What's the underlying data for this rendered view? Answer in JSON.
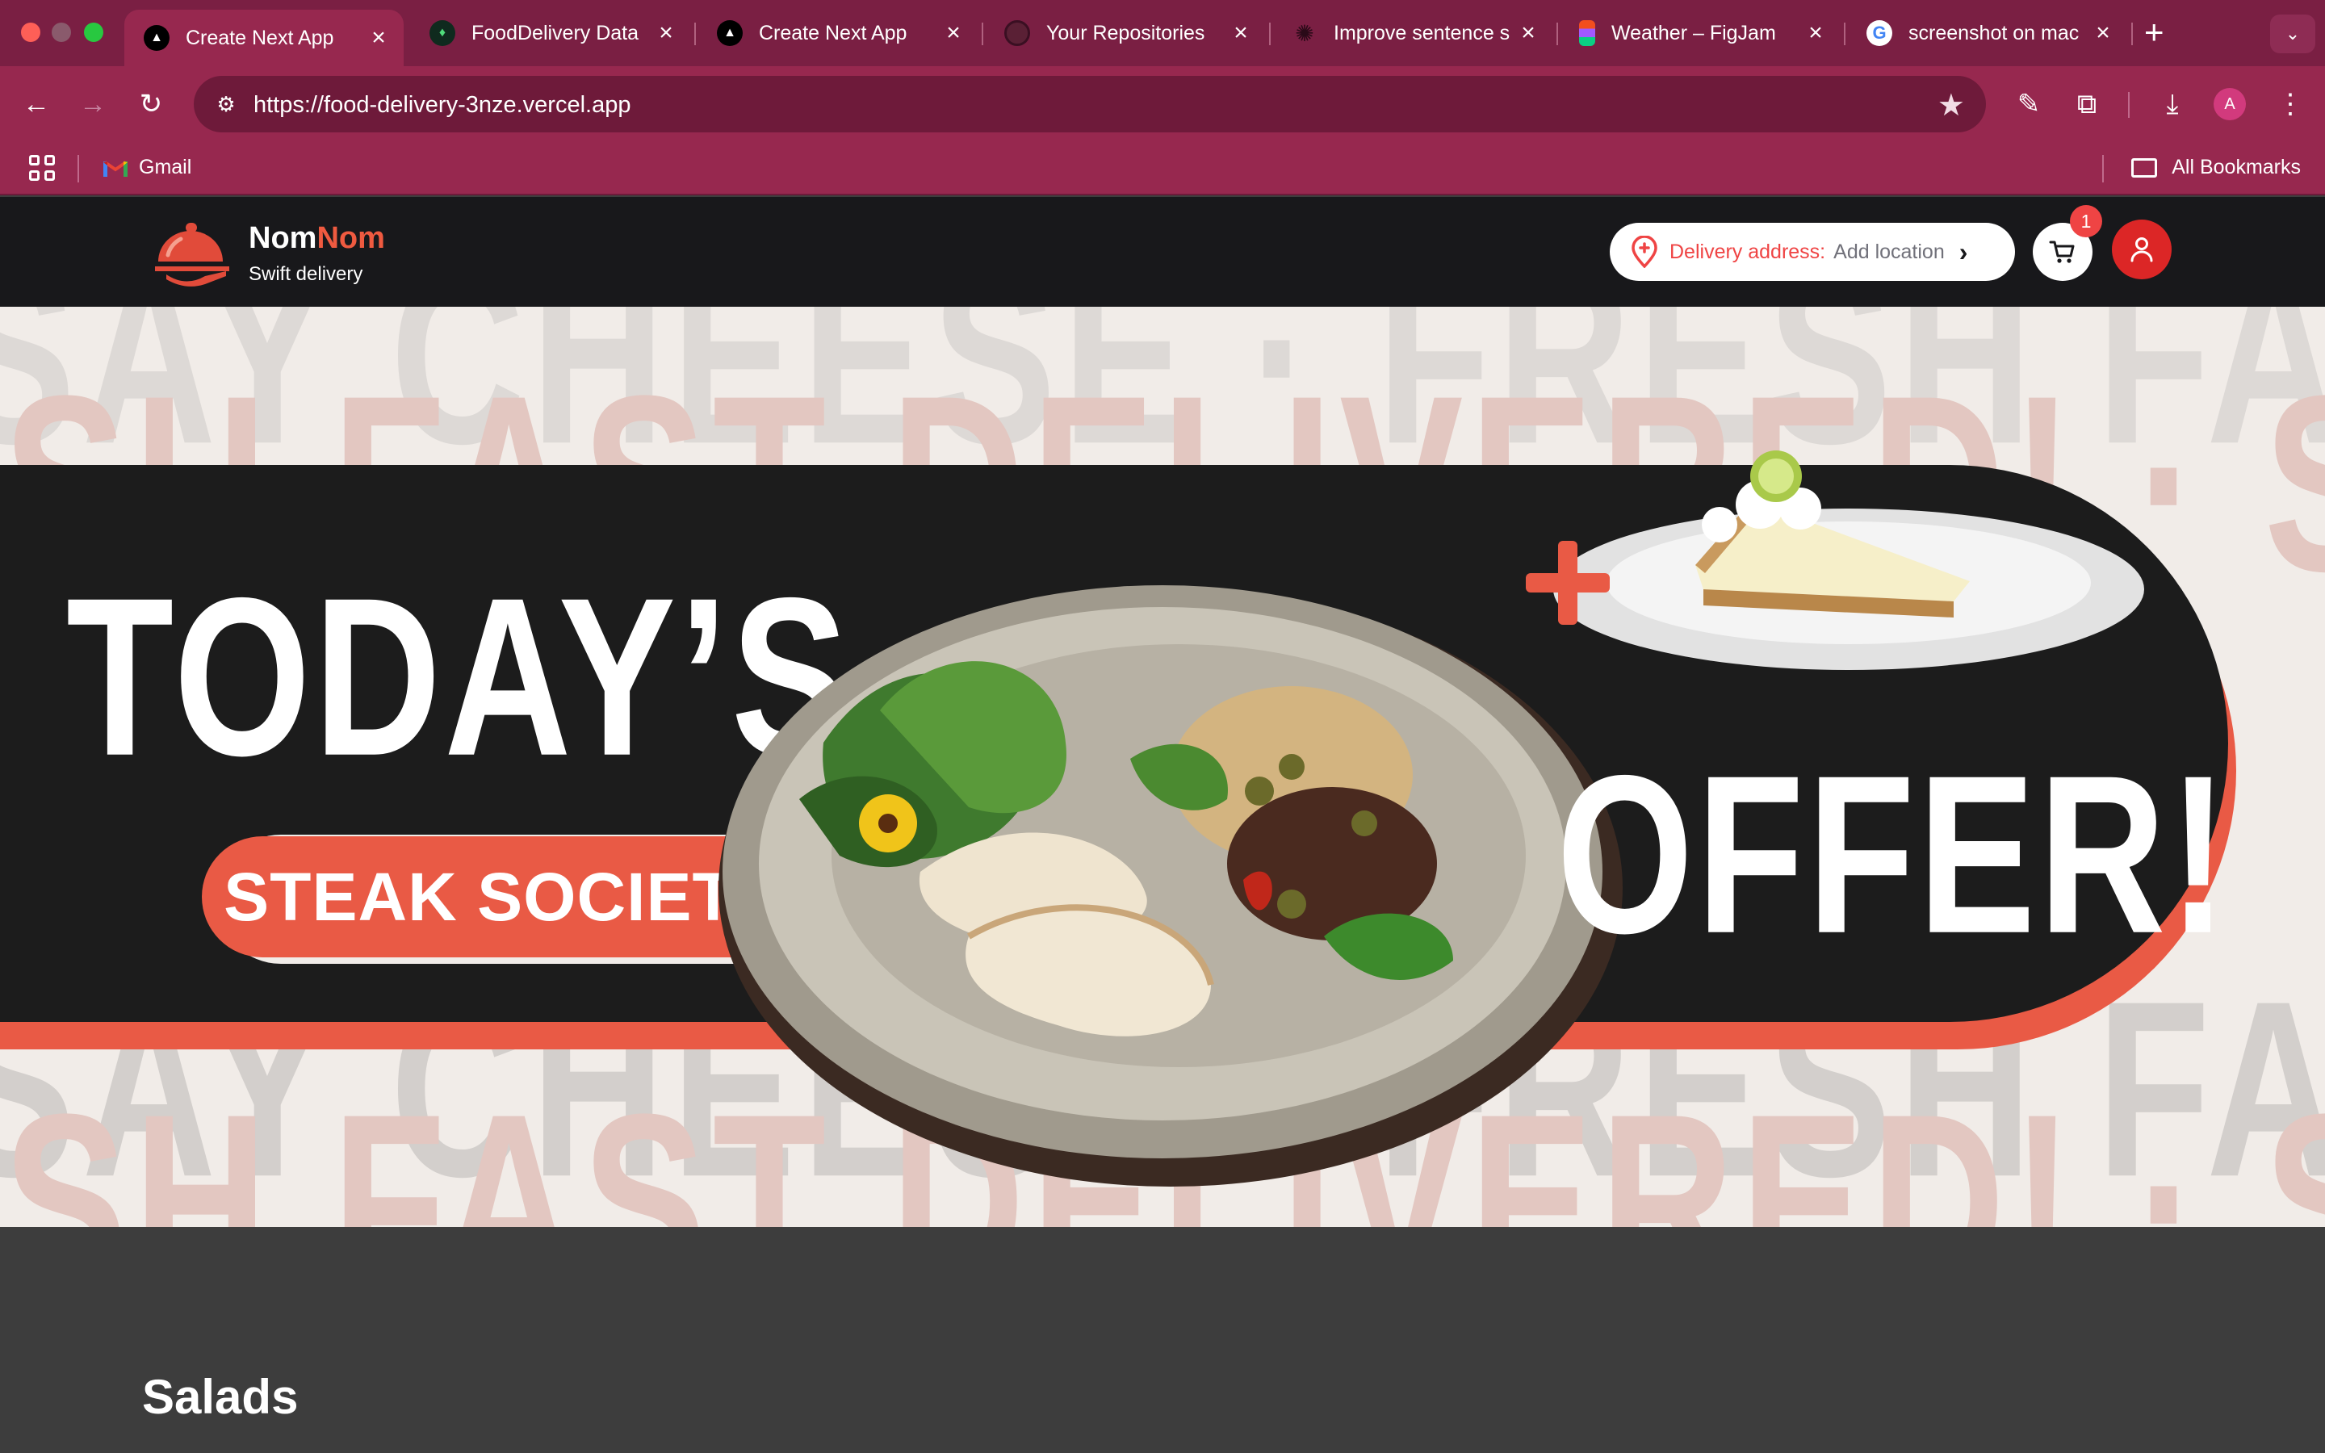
{
  "browser": {
    "tabs": [
      {
        "title": "Create Next App",
        "icon": "vercel-triangle-icon",
        "active": true
      },
      {
        "title": "FoodDelivery Data",
        "icon": "mongodb-leaf-icon",
        "active": false
      },
      {
        "title": "Create Next App",
        "icon": "vercel-triangle-icon",
        "active": false
      },
      {
        "title": "Your Repositories",
        "icon": "github-icon",
        "active": false
      },
      {
        "title": "Improve sentence s",
        "icon": "openai-icon",
        "active": false
      },
      {
        "title": "Weather – FigJam",
        "icon": "figma-icon",
        "active": false
      },
      {
        "title": "screenshot on mac",
        "icon": "google-icon",
        "active": false
      }
    ],
    "url": "https://food-delivery-3nze.vercel.app",
    "profile_initial": "A",
    "bookmarks": {
      "gmail": "Gmail",
      "all": "All Bookmarks"
    },
    "colors": {
      "tabstrip": "#7a1f43",
      "toolbar": "#97284f"
    }
  },
  "header": {
    "brand_primary": "Nom",
    "brand_accent": "Nom",
    "tagline": "Swift delivery",
    "address_label": "Delivery address:",
    "address_value": "Add location",
    "cart_count": "1",
    "colors": {
      "accent": "#ef5a40",
      "user_button": "#dc2626"
    }
  },
  "hero": {
    "headline_left": "TODAY’S",
    "headline_right": "OFFER!",
    "restaurant_badge": "STEAK SOCIETY",
    "background_lines": [
      "SAY CHEESE · FRESH FAST DELIVERED! · SAY CHEESE",
      "FRESH FAST DELIVERED! · SAY CHEESE · FRESH FAST",
      "SAY CHEESE · FRESH FAST DELIVERED! · SAY CHEESE",
      "FRESH FAST DELIVERED! · SAY CHEESE · FRESH FAST"
    ],
    "colors": {
      "band": "#1c1c1c",
      "accent": "#e95a45",
      "background": "#f1ece8"
    }
  },
  "section": {
    "title": "Salads"
  }
}
